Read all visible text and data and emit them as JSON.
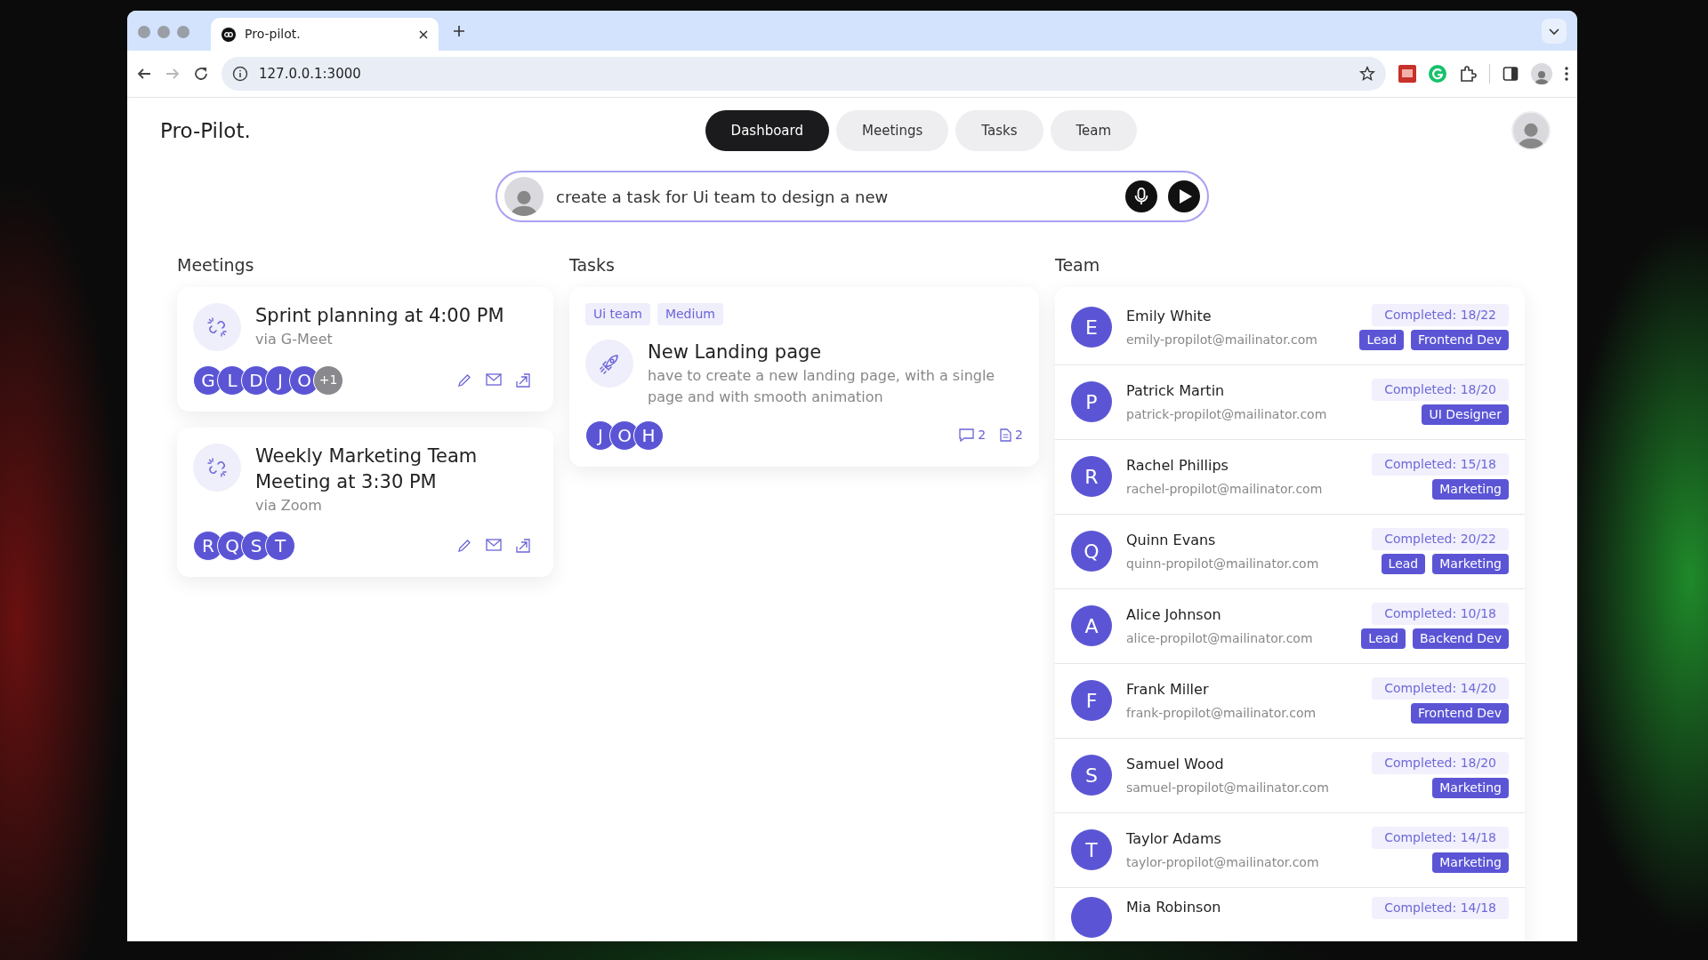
{
  "browser": {
    "tab_title": "Pro-pilot.",
    "url": "127.0.0.1:3000",
    "forward_disabled": true
  },
  "app": {
    "logo": "Pro-Pilot.",
    "nav": [
      {
        "label": "Dashboard",
        "selected": true
      },
      {
        "label": "Meetings",
        "selected": false
      },
      {
        "label": "Tasks",
        "selected": false
      },
      {
        "label": "Team",
        "selected": false
      }
    ],
    "prompt": {
      "value": "create a task for Ui team to design a new"
    },
    "meetings": {
      "heading": "Meetings",
      "items": [
        {
          "title": "Sprint planning at 4:00 PM",
          "via": "via G-Meet",
          "attendees": [
            "G",
            "L",
            "D",
            "J",
            "O"
          ],
          "extra": "+1"
        },
        {
          "title": "Weekly Marketing Team Meeting at 3:30 PM",
          "via": "via Zoom",
          "attendees": [
            "R",
            "Q",
            "S",
            "T"
          ]
        }
      ]
    },
    "tasks": {
      "heading": "Tasks",
      "items": [
        {
          "tags": [
            "Ui team",
            "Medium"
          ],
          "title": "New Landing page",
          "description": "have to create a new landing page, with a single page and with smooth animation",
          "assignees": [
            "J",
            "O",
            "H"
          ],
          "comments": "2",
          "attachments": "2"
        }
      ]
    },
    "team": {
      "heading": "Team",
      "members": [
        {
          "initial": "E",
          "name": "Emily White",
          "email": "emily-propilot@mailinator.com",
          "completed": "Completed: 18/22",
          "roles": [
            "Lead",
            "Frontend Dev"
          ]
        },
        {
          "initial": "P",
          "name": "Patrick Martin",
          "email": "patrick-propilot@mailinator.com",
          "completed": "Completed: 18/20",
          "roles": [
            "UI Designer"
          ]
        },
        {
          "initial": "R",
          "name": "Rachel Phillips",
          "email": "rachel-propilot@mailinator.com",
          "completed": "Completed: 15/18",
          "roles": [
            "Marketing"
          ]
        },
        {
          "initial": "Q",
          "name": "Quinn Evans",
          "email": "quinn-propilot@mailinator.com",
          "completed": "Completed: 20/22",
          "roles": [
            "Lead",
            "Marketing"
          ]
        },
        {
          "initial": "A",
          "name": "Alice Johnson",
          "email": "alice-propilot@mailinator.com",
          "completed": "Completed: 10/18",
          "roles": [
            "Lead",
            "Backend Dev"
          ]
        },
        {
          "initial": "F",
          "name": "Frank Miller",
          "email": "frank-propilot@mailinator.com",
          "completed": "Completed: 14/20",
          "roles": [
            "Frontend Dev"
          ]
        },
        {
          "initial": "S",
          "name": "Samuel Wood",
          "email": "samuel-propilot@mailinator.com",
          "completed": "Completed: 18/20",
          "roles": [
            "Marketing"
          ]
        },
        {
          "initial": "T",
          "name": "Taylor Adams",
          "email": "taylor-propilot@mailinator.com",
          "completed": "Completed: 14/18",
          "roles": [
            "Marketing"
          ]
        },
        {
          "name": "Mia Robinson",
          "completed": "Completed: 14/18"
        }
      ]
    }
  }
}
